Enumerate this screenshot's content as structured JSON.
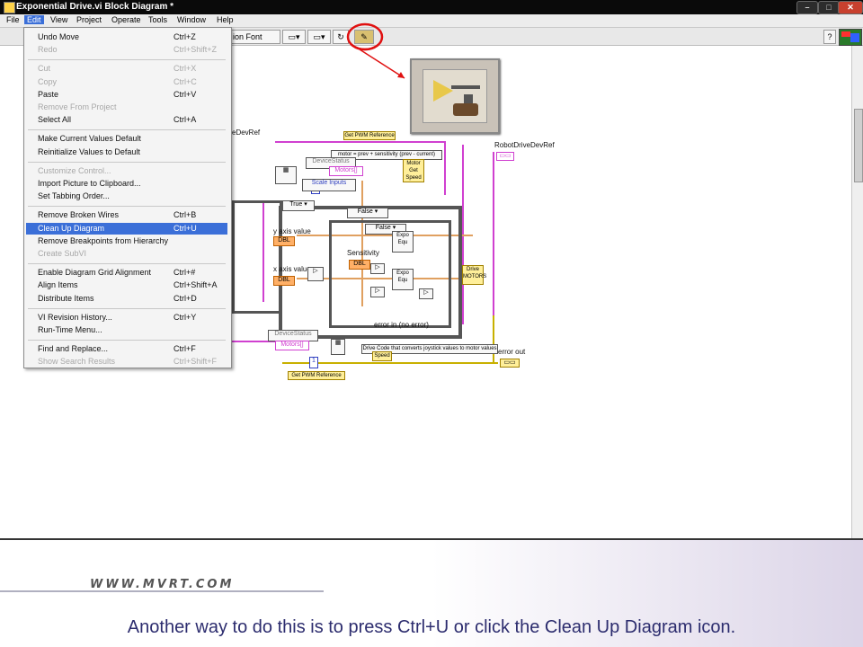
{
  "window": {
    "title": "Exponential Drive.vi Block Diagram *",
    "controls": [
      "–",
      "□",
      "✕"
    ]
  },
  "menubar": [
    "File",
    "Edit",
    "View",
    "Project",
    "Operate",
    "Tools",
    "Window",
    "Help"
  ],
  "toolbar": {
    "font_label": "ion Font"
  },
  "edit_menu": [
    {
      "label": "Undo Move",
      "shortcut": "Ctrl+Z",
      "enabled": true
    },
    {
      "label": "Redo",
      "shortcut": "Ctrl+Shift+Z",
      "enabled": false
    },
    {
      "sep": true
    },
    {
      "label": "Cut",
      "shortcut": "Ctrl+X",
      "enabled": false
    },
    {
      "label": "Copy",
      "shortcut": "Ctrl+C",
      "enabled": false
    },
    {
      "label": "Paste",
      "shortcut": "Ctrl+V",
      "enabled": true
    },
    {
      "label": "Remove From Project",
      "shortcut": "",
      "enabled": false
    },
    {
      "label": "Select All",
      "shortcut": "Ctrl+A",
      "enabled": true
    },
    {
      "sep": true
    },
    {
      "label": "Make Current Values Default",
      "shortcut": "",
      "enabled": true
    },
    {
      "label": "Reinitialize Values to Default",
      "shortcut": "",
      "enabled": true
    },
    {
      "sep": true
    },
    {
      "label": "Customize Control...",
      "shortcut": "",
      "enabled": false
    },
    {
      "label": "Import Picture to Clipboard...",
      "shortcut": "",
      "enabled": true
    },
    {
      "label": "Set Tabbing Order...",
      "shortcut": "",
      "enabled": true
    },
    {
      "sep": true
    },
    {
      "label": "Remove Broken Wires",
      "shortcut": "Ctrl+B",
      "enabled": true
    },
    {
      "label": "Clean Up Diagram",
      "shortcut": "Ctrl+U",
      "enabled": true,
      "highlighted": true
    },
    {
      "label": "Remove Breakpoints from Hierarchy",
      "shortcut": "",
      "enabled": true
    },
    {
      "label": "Create SubVI",
      "shortcut": "",
      "enabled": false
    },
    {
      "sep": true
    },
    {
      "label": "Enable Diagram Grid Alignment",
      "shortcut": "Ctrl+#",
      "enabled": true
    },
    {
      "label": "Align Items",
      "shortcut": "Ctrl+Shift+A",
      "enabled": true
    },
    {
      "label": "Distribute Items",
      "shortcut": "Ctrl+D",
      "enabled": true
    },
    {
      "sep": true
    },
    {
      "label": "VI Revision History...",
      "shortcut": "Ctrl+Y",
      "enabled": true
    },
    {
      "label": "Run-Time Menu...",
      "shortcut": "",
      "enabled": true
    },
    {
      "sep": true
    },
    {
      "label": "Find and Replace...",
      "shortcut": "Ctrl+F",
      "enabled": true
    },
    {
      "label": "Show Search Results",
      "shortcut": "Ctrl+Shift+F",
      "enabled": false
    }
  ],
  "diagram": {
    "labels": {
      "dev_ref_left": "eDevRef",
      "get_pwm_top": "Get PWM Reference",
      "formula": "motor = prev + sensitivity (prev - current)",
      "device_status_top": "DeviceStatus",
      "motors_top": "Motors[]",
      "motor_speed": "Motor\nGet\nSpeed",
      "scale_inputs": "Scale Inputs",
      "robot_drive_ref": "RobotDriveDevRef",
      "true_case": "True",
      "false_case_outer": "False",
      "false_case_inner": "False",
      "y_axis": "y axis value",
      "x_axis": "x axis value",
      "dbl1": "DBL",
      "dbl2": "DBL",
      "dbl3": "DBL",
      "sensitivity": "Sensitivity",
      "expo1": "Expo\nEqu",
      "expo2": "Expo\nEqu",
      "drive": "Drive\nMOTORS",
      "error_in": "error in (no error)",
      "device_status_bottom": "DeviceStatus",
      "motors_bottom": "Motors[]",
      "drive_comment": "Drive Code that converts joystick values to motor values",
      "motor_speed_bottom": "Speed",
      "get_pwm_bottom": "Get PWM Reference",
      "error_out": "error out",
      "const_one": "1",
      "const_zero": "0"
    }
  },
  "zoom_icon": "clean-up-diagram-icon",
  "footer": {
    "brand": "WWW.MVRT.COM",
    "caption": "Another way to do this is to press Ctrl+U or click the Clean Up Diagram icon."
  },
  "colors": {
    "highlight": "#3b6fd8",
    "annotation_red": "#e01010",
    "wire_pink": "#d040d0",
    "wire_orange": "#e0a060",
    "caption": "#2c2c6e"
  }
}
